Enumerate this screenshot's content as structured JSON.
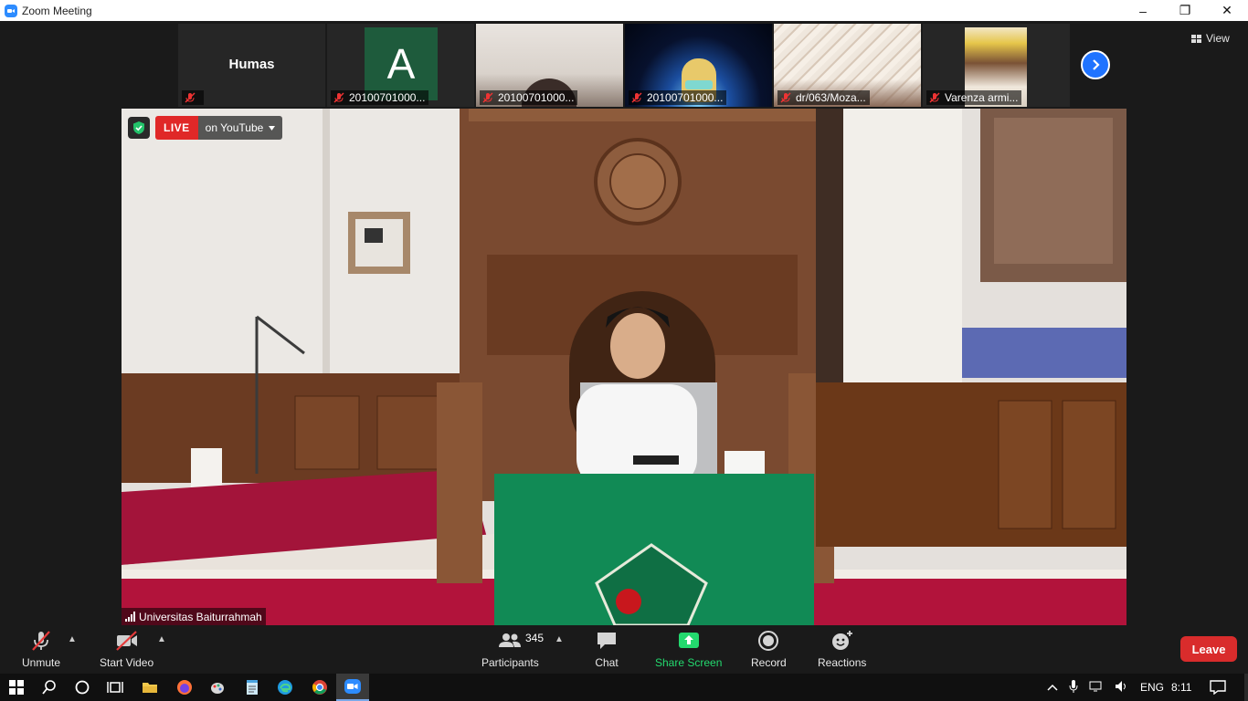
{
  "window": {
    "title": "Zoom Meeting",
    "minimize": "–",
    "restore": "❐",
    "close": "✕"
  },
  "thumbnails": [
    {
      "name": "",
      "big_name": "Humas"
    },
    {
      "name": "20100701000...",
      "initial": "A"
    },
    {
      "name": "20100701000..."
    },
    {
      "name": "20100701000..."
    },
    {
      "name": "dr/063/Moza..."
    },
    {
      "name": "Varenza armi..."
    }
  ],
  "view_button": {
    "label": "View"
  },
  "live": {
    "badge": "LIVE",
    "destination": "on YouTube"
  },
  "active_speaker": {
    "name": "Universitas Baiturrahmah"
  },
  "controls": {
    "unmute": "Unmute",
    "start_video": "Start Video",
    "participants": "Participants",
    "participants_count": "345",
    "chat": "Chat",
    "share_screen": "Share Screen",
    "record": "Record",
    "reactions": "Reactions",
    "leave": "Leave"
  },
  "taskbar": {
    "language": "ENG",
    "time": "8:11"
  },
  "colors": {
    "accent_blue": "#2d8cff",
    "live_red": "#e02828",
    "share_green": "#23d96e",
    "leave_red": "#d92c2c"
  }
}
